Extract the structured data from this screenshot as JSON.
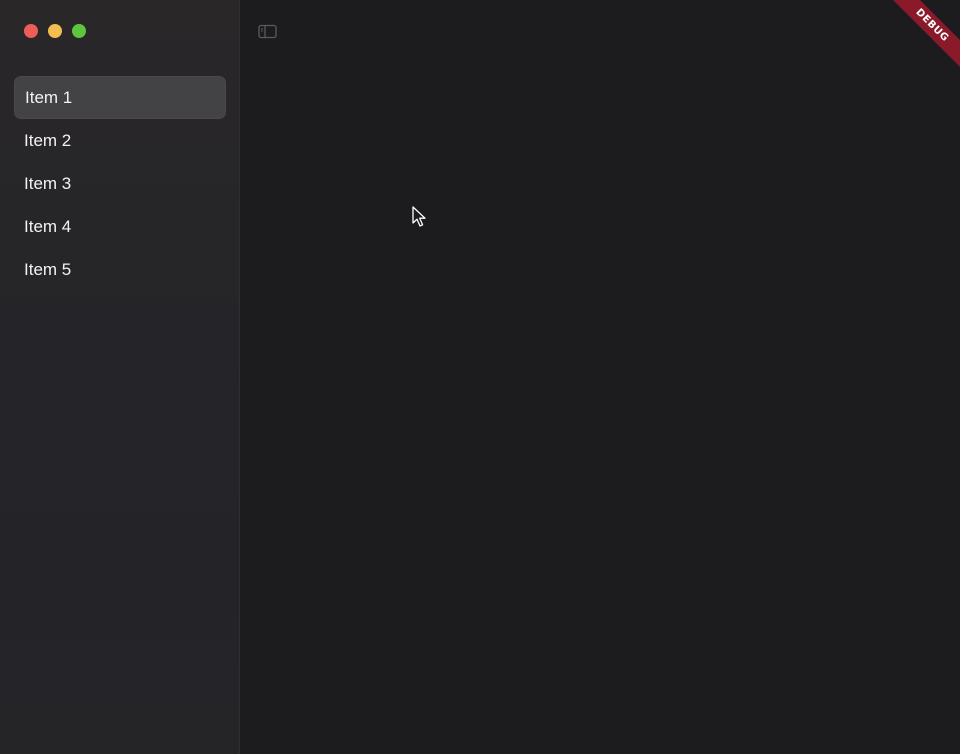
{
  "window": {
    "traffic_lights": [
      {
        "name": "close",
        "color": "#ec5e57"
      },
      {
        "name": "minimize",
        "color": "#f4bd4f"
      },
      {
        "name": "zoom",
        "color": "#5fc53e"
      }
    ]
  },
  "sidebar": {
    "items": [
      {
        "label": "Item 1",
        "selected": true
      },
      {
        "label": "Item 2",
        "selected": false
      },
      {
        "label": "Item 3",
        "selected": false
      },
      {
        "label": "Item 4",
        "selected": false
      },
      {
        "label": "Item 5",
        "selected": false
      }
    ]
  },
  "toolbar": {
    "toggle_icon": "sidebar-toggle-icon"
  },
  "debug_banner": {
    "label": "DEBUG",
    "color": "#8a1a2a"
  },
  "colors": {
    "sidebar_bg": "#262528",
    "content_bg": "#1c1c1e",
    "selected_bg": "#434245",
    "text": "#f2f2f4"
  }
}
